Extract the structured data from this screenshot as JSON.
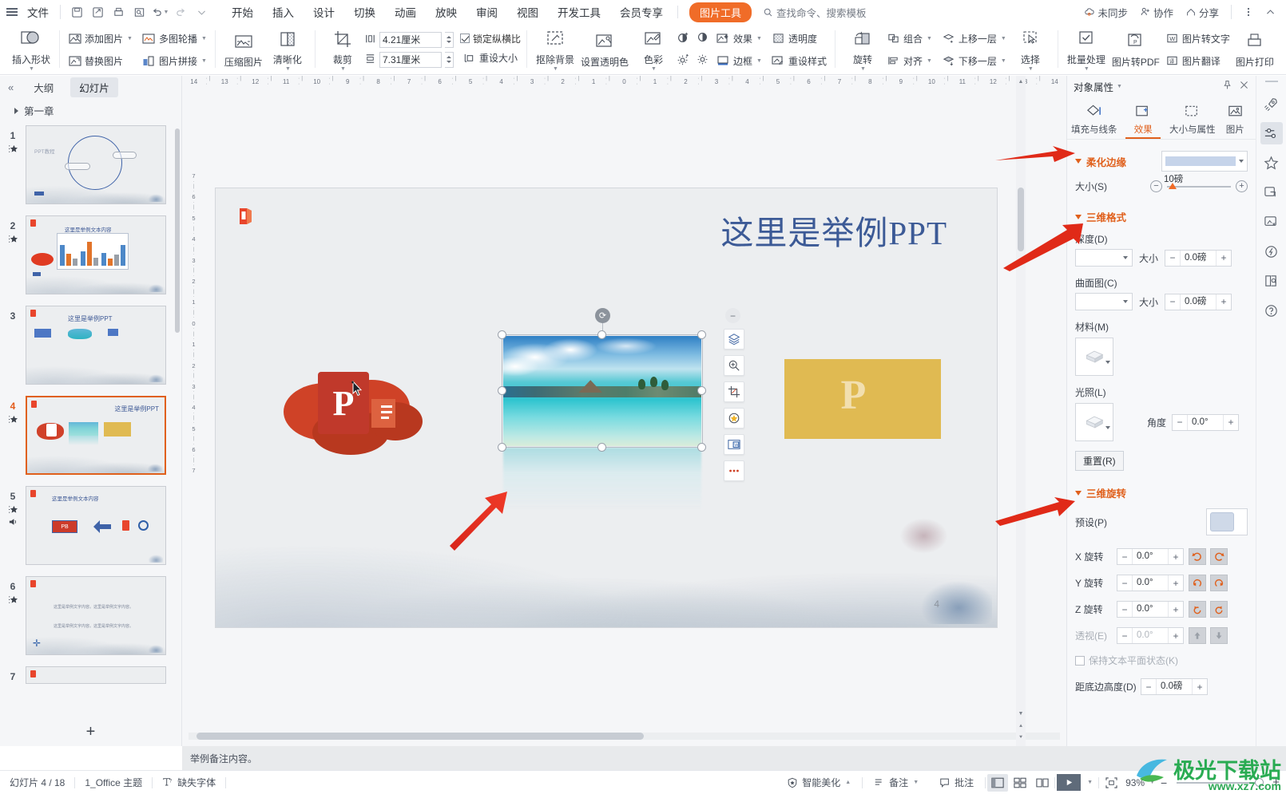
{
  "topbar": {
    "file_label": "文件",
    "quick_icons": [
      "save-icon",
      "save-as-icon",
      "print-icon",
      "print-preview-icon",
      "undo-icon",
      "redo-icon",
      "customize-icon"
    ],
    "tabs": [
      "开始",
      "插入",
      "设计",
      "切换",
      "动画",
      "放映",
      "审阅",
      "视图",
      "开发工具",
      "会员专享"
    ],
    "active_tab": "图片工具",
    "search_placeholder": "查找命令、搜索模板",
    "right_items": [
      {
        "label": "未同步",
        "icon": "cloud-sync-icon"
      },
      {
        "label": "协作",
        "icon": "collaborate-icon"
      },
      {
        "label": "分享",
        "icon": "share-icon"
      }
    ],
    "more_icon": "more-vertical-icon",
    "collapse_icon": "chevron-up-icon"
  },
  "ribbon": {
    "insert_shape": "插入形状",
    "add_picture": "添加图片",
    "replace_picture": "替换图片",
    "multi_carousel": "多图轮播",
    "picture_stitch": "图片拼接",
    "compress": "压缩图片",
    "sharpen": "清晰化",
    "crop": "裁剪",
    "width_value": "4.21厘米",
    "height_value": "7.31厘米",
    "lock_ratio": "锁定纵横比",
    "lock_ratio_checked": true,
    "reset_size": "重设大小",
    "remove_bg": "抠除背景",
    "set_transparent_color": "设置透明色",
    "color": "色彩",
    "effect": "效果",
    "transparency": "透明度",
    "border": "边框",
    "reset_style": "重设样式",
    "rotate": "旋转",
    "group": "组合",
    "align": "对齐",
    "bring_forward": "上移一层",
    "send_backward": "下移一层",
    "select": "选择",
    "batch_process": "批量处理",
    "pic_to_pdf": "图片转PDF",
    "pic_to_text": "图片转文字",
    "pic_translate": "图片翻译",
    "pic_print": "图片打印"
  },
  "left_panel": {
    "collapse_icon": "double-chevron-left-icon",
    "tab_outline": "大纲",
    "tab_slides": "幻灯片",
    "slides_tab_active": true,
    "chapter": "第一章",
    "slides": [
      {
        "num": "1",
        "title": "PPT教程",
        "has_star": true,
        "has_audio": false,
        "selected": false
      },
      {
        "num": "2",
        "title": "这里是举例文本内容",
        "has_star": true,
        "has_audio": false,
        "selected": false
      },
      {
        "num": "3",
        "title": "这里是举例PPT",
        "has_star": false,
        "has_audio": false,
        "selected": false
      },
      {
        "num": "4",
        "title": "这里是举例PPT",
        "has_star": true,
        "has_audio": false,
        "selected": true
      },
      {
        "num": "5",
        "title": "这里是举例文本内容",
        "has_star": true,
        "has_audio": true,
        "selected": false
      },
      {
        "num": "6",
        "title": "这里是举例文字内容。这里是举例文字内容。",
        "has_star": true,
        "has_audio": false,
        "selected": false
      },
      {
        "num": "7",
        "title": "",
        "has_star": false,
        "has_audio": false,
        "selected": false
      }
    ],
    "add_slide_icon": "plus-icon"
  },
  "canvas": {
    "ruler_ticks": [
      "14",
      "13",
      "12",
      "11",
      "10",
      "9",
      "8",
      "7",
      "6",
      "5",
      "4",
      "3",
      "2",
      "1",
      "0",
      "1",
      "2",
      "3",
      "4",
      "5",
      "6",
      "7",
      "8",
      "9",
      "10",
      "11",
      "12",
      "13",
      "14"
    ],
    "vruler_ticks": [
      "7",
      "6",
      "5",
      "4",
      "3",
      "2",
      "1",
      "0",
      "1",
      "2",
      "3",
      "4",
      "5",
      "6",
      "7"
    ],
    "slide_title": "这里是举例PPT",
    "slide_number": "4",
    "ppt_letter": "P",
    "gold_letter": "P",
    "float_tools": [
      {
        "name": "collapse-toolbar-icon",
        "glyph": "−"
      },
      {
        "name": "layers-icon",
        "glyph": "layers"
      },
      {
        "name": "zoom-in-icon",
        "glyph": "zoom"
      },
      {
        "name": "crop-icon",
        "glyph": "crop"
      },
      {
        "name": "smart-effect-icon",
        "glyph": "bulb"
      },
      {
        "name": "picture-text-icon",
        "glyph": "pictext"
      },
      {
        "name": "more-options-icon",
        "glyph": "dots"
      }
    ]
  },
  "notes": {
    "text": "举例备注内容。"
  },
  "right_panel": {
    "title": "对象属性",
    "pin_icon": "pin-icon",
    "close_icon": "close-icon",
    "tabs": [
      {
        "label": "填充与线条",
        "icon": "fill-line-icon",
        "active": false
      },
      {
        "label": "效果",
        "icon": "effects-icon",
        "active": true
      },
      {
        "label": "大小与属性",
        "icon": "size-properties-icon",
        "active": false
      },
      {
        "label": "图片",
        "icon": "picture-icon",
        "active": false
      }
    ],
    "sections": {
      "soft_edge": {
        "title": "柔化边缘",
        "size_label": "大小(S)",
        "size_value": "10磅"
      },
      "three_d_format": {
        "title": "三维格式",
        "depth_label": "深度(D)",
        "depth_size_label": "大小",
        "depth_size_value": "0.0磅",
        "contour_label": "曲面图(C)",
        "contour_size_label": "大小",
        "contour_size_value": "0.0磅",
        "material_label": "材料(M)",
        "lighting_label": "光照(L)",
        "angle_label": "角度",
        "angle_value": "0.0°",
        "reset_label": "重置(R)"
      },
      "three_d_rotation": {
        "title": "三维旋转",
        "preset_label": "预设(P)",
        "x_label": "X 旋转",
        "x_value": "0.0°",
        "y_label": "Y 旋转",
        "y_value": "0.0°",
        "z_label": "Z 旋转",
        "z_value": "0.0°",
        "perspective_label": "透视(E)",
        "perspective_value": "0.0°",
        "keep_text_flat_label": "保持文本平面状态(K)",
        "distance_label": "距底边高度(D)",
        "distance_value": "0.0磅"
      }
    }
  },
  "rail": {
    "icons": [
      {
        "name": "rocket-icon",
        "active": false
      },
      {
        "name": "properties-sliders-icon",
        "active": true
      },
      {
        "name": "star-effects-icon",
        "active": false
      },
      {
        "name": "frame-icon",
        "active": false
      },
      {
        "name": "material-library-icon",
        "active": false
      },
      {
        "name": "brain-idea-icon",
        "active": false
      },
      {
        "name": "document-search-icon",
        "active": false
      },
      {
        "name": "help-icon",
        "active": false
      }
    ]
  },
  "statusbar": {
    "slide_count": "幻灯片 4 / 18",
    "theme": "1_Office 主题",
    "missing_font": "缺失字体",
    "smart_beautify": "智能美化",
    "notes": "备注",
    "comments": "批注",
    "view_buttons": [
      "normal-view-icon",
      "slide-sorter-icon",
      "reading-view-icon"
    ],
    "play_icon": "play-icon",
    "fit_icon": "fit-to-window-icon",
    "zoom": "93%",
    "minus": "−",
    "plus": "+"
  },
  "watermark": {
    "text": "极光下载站",
    "url": "www.xz7.com"
  },
  "colors": {
    "accent_orange": "#e0601c",
    "tab_pill": "#f06c28",
    "title_blue": "#3c5a96",
    "panel_bg": "#f7f8fa",
    "slide_bg": "#eceef0",
    "gold": "#e0ba52",
    "ppt_red": "#c0392b"
  }
}
